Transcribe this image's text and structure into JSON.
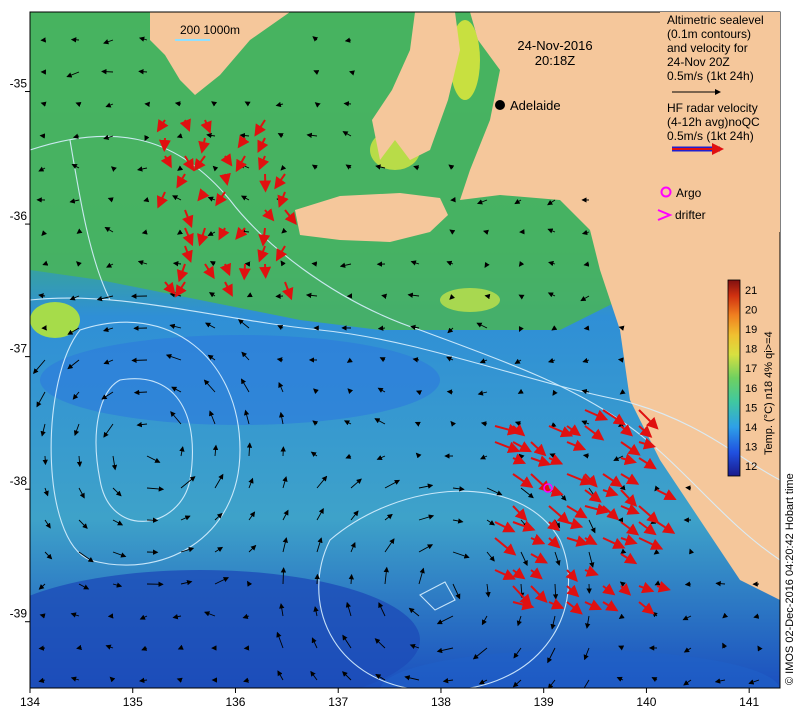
{
  "title": {
    "date": "24-Nov-2016",
    "time": "20:18Z"
  },
  "scale_bar": {
    "label": "200  1000m"
  },
  "places": [
    {
      "name": "Adelaide",
      "lon": 138.6,
      "lat": -34.93
    }
  ],
  "legend": {
    "altimetry_lines": [
      "Altimetric sealevel",
      "(0.1m contours)",
      "and velocity for",
      "24-Nov 20Z",
      "0.5m/s (1kt 24h)"
    ],
    "radar_lines": [
      "HF radar velocity",
      "(4-12h avg)noQC",
      "0.5m/s (1kt 24h)"
    ],
    "argo_label": "Argo",
    "drifter_label": "drifter",
    "colors": {
      "altimetry": "#000000",
      "radar": "#e01010",
      "radar_outline": "#2020d0",
      "argo": "#ff00ff",
      "drifter": "#ff00ff"
    }
  },
  "colorbar": {
    "label": "Temp. (°C) n18 4% qi>=4",
    "ticks": [
      12,
      13,
      14,
      15,
      16,
      17,
      18,
      19,
      20,
      21
    ],
    "range": [
      11.5,
      21.5
    ]
  },
  "credit": "© IMOS 02-Dec-2016 04:20:42 Hobart time",
  "axes": {
    "lon_ticks": [
      134,
      135,
      136,
      137,
      138,
      139,
      140,
      141
    ],
    "lat_ticks": [
      -35,
      -36,
      -37,
      -38,
      -39
    ],
    "lon_range": [
      134,
      141.3
    ],
    "lat_range": [
      -34.4,
      -39.5
    ]
  },
  "colors": {
    "land": "#f5c79b",
    "deep_sea": "#1f5fd0",
    "shelf_sea": "#35b590"
  }
}
